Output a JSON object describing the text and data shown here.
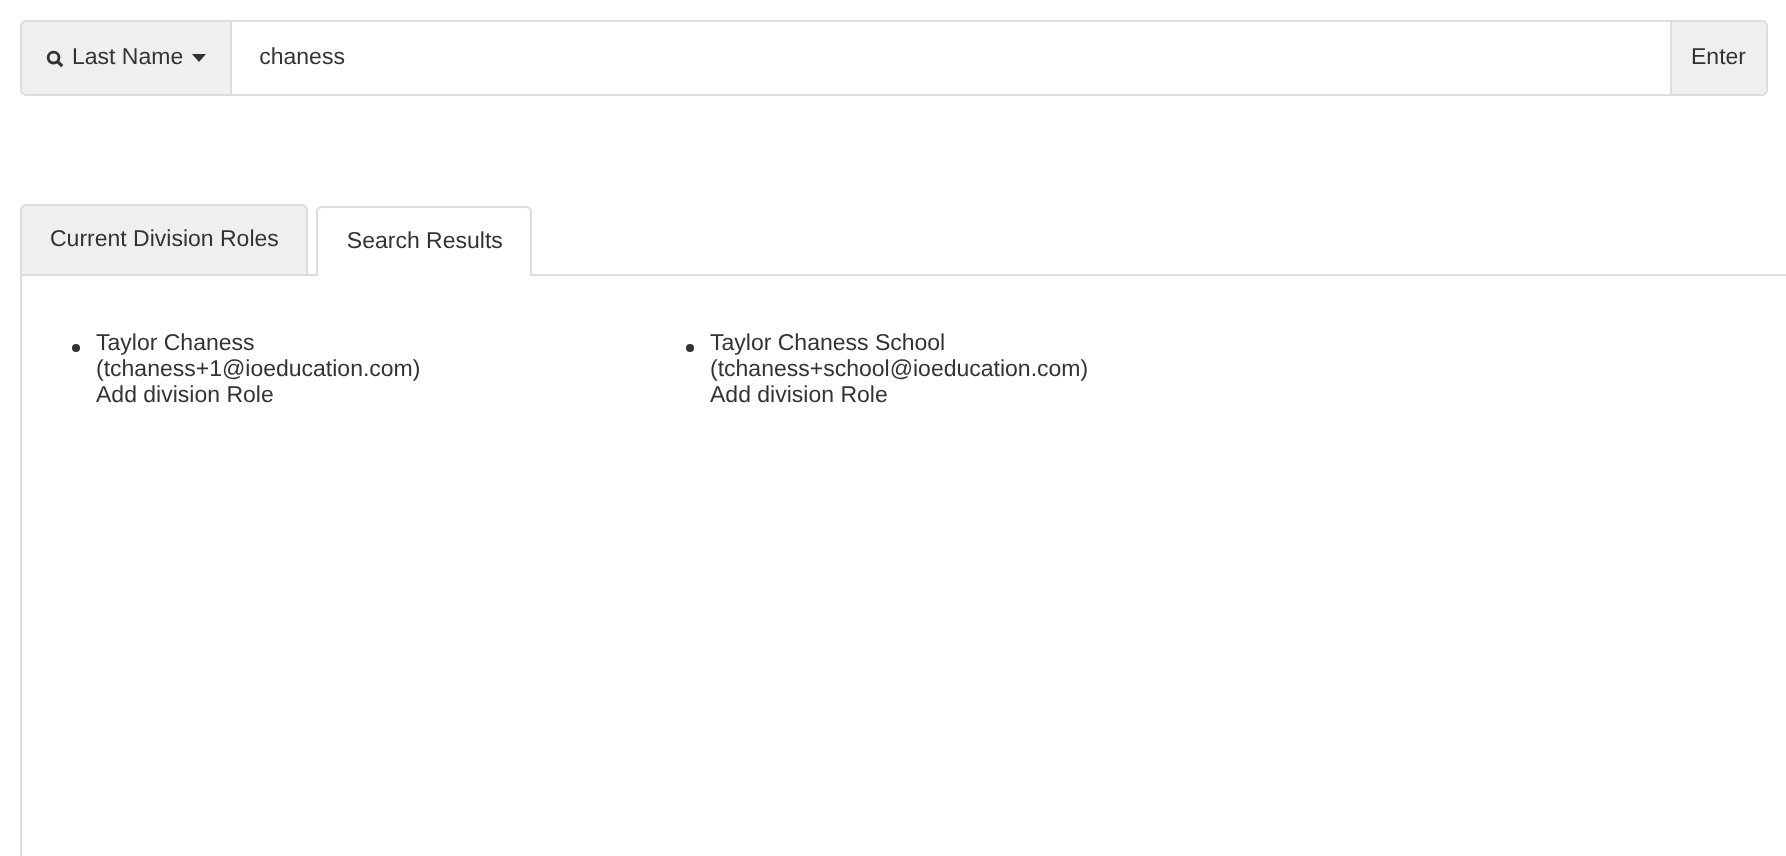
{
  "search": {
    "filter_label": "Last Name",
    "value": "chaness",
    "button": "Enter"
  },
  "tabs": [
    {
      "label": "Current Division Roles",
      "selected": false
    },
    {
      "label": "Search Results",
      "selected": true
    }
  ],
  "results": [
    {
      "name": "Taylor Chaness",
      "email": "(tchaness+1@ioeducation.com)",
      "action": "Add division Role"
    },
    {
      "name": "Taylor Chaness School",
      "email": "(tchaness+school@ioeducation.com)",
      "action": "Add division Role"
    }
  ]
}
